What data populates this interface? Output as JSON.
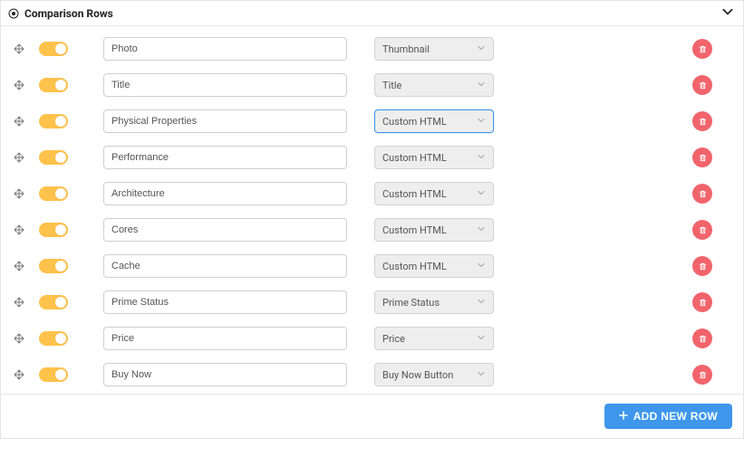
{
  "header": {
    "title": "Comparison Rows"
  },
  "rows": [
    {
      "name": "Photo",
      "type": "Thumbnail",
      "focused": false
    },
    {
      "name": "Title",
      "type": "Title",
      "focused": false
    },
    {
      "name": "Physical Properties",
      "type": "Custom HTML",
      "focused": true
    },
    {
      "name": "Performance",
      "type": "Custom HTML",
      "focused": false
    },
    {
      "name": "Architecture",
      "type": "Custom HTML",
      "focused": false
    },
    {
      "name": "Cores",
      "type": "Custom HTML",
      "focused": false
    },
    {
      "name": "Cache",
      "type": "Custom HTML",
      "focused": false
    },
    {
      "name": "Prime Status",
      "type": "Prime Status",
      "focused": false
    },
    {
      "name": "Price",
      "type": "Price",
      "focused": false
    },
    {
      "name": "Buy Now",
      "type": "Buy Now Button",
      "focused": false
    }
  ],
  "footer": {
    "add_label": "ADD NEW ROW"
  }
}
